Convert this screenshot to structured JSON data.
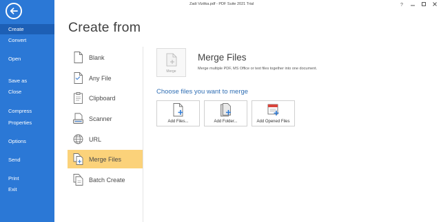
{
  "window": {
    "title": "Zadi Vizitka.pdf  -  PDF Suite 2021 Trial"
  },
  "sidebar": {
    "items": [
      {
        "label": "Create",
        "active": true
      },
      {
        "label": "Convert"
      },
      {
        "label": "Open"
      },
      {
        "label": "Save as"
      },
      {
        "label": "Close"
      },
      {
        "label": "Compress"
      },
      {
        "label": "Properties"
      },
      {
        "label": "Options"
      },
      {
        "label": "Send"
      },
      {
        "label": "Print"
      },
      {
        "label": "Exit"
      }
    ]
  },
  "main": {
    "title": "Create from",
    "options": [
      {
        "label": "Blank",
        "icon": "blank-page-icon"
      },
      {
        "label": "Any File",
        "icon": "any-file-icon"
      },
      {
        "label": "Clipboard",
        "icon": "clipboard-icon"
      },
      {
        "label": "Scanner",
        "icon": "scanner-icon"
      },
      {
        "label": "URL",
        "icon": "globe-icon"
      },
      {
        "label": "Merge Files",
        "icon": "merge-files-icon",
        "selected": true
      },
      {
        "label": "Batch Create",
        "icon": "batch-create-icon"
      }
    ]
  },
  "panel": {
    "icon_label": "Merge",
    "title": "Merge Files",
    "description": "Merge multiple PDF, MS Office or text files together into one document.",
    "choose_heading": "Choose files you want to merge",
    "buttons": [
      {
        "label": "Add Files...",
        "icon": "add-files-icon"
      },
      {
        "label": "Add Folder...",
        "icon": "add-folder-icon"
      },
      {
        "label": "Add Opened Files",
        "icon": "add-opened-files-icon"
      }
    ]
  },
  "colors": {
    "sidebar_bg": "#2b78d6",
    "sidebar_active": "#1d5fb5",
    "selected_option": "#fbd27a",
    "link_blue": "#2e6db3"
  }
}
